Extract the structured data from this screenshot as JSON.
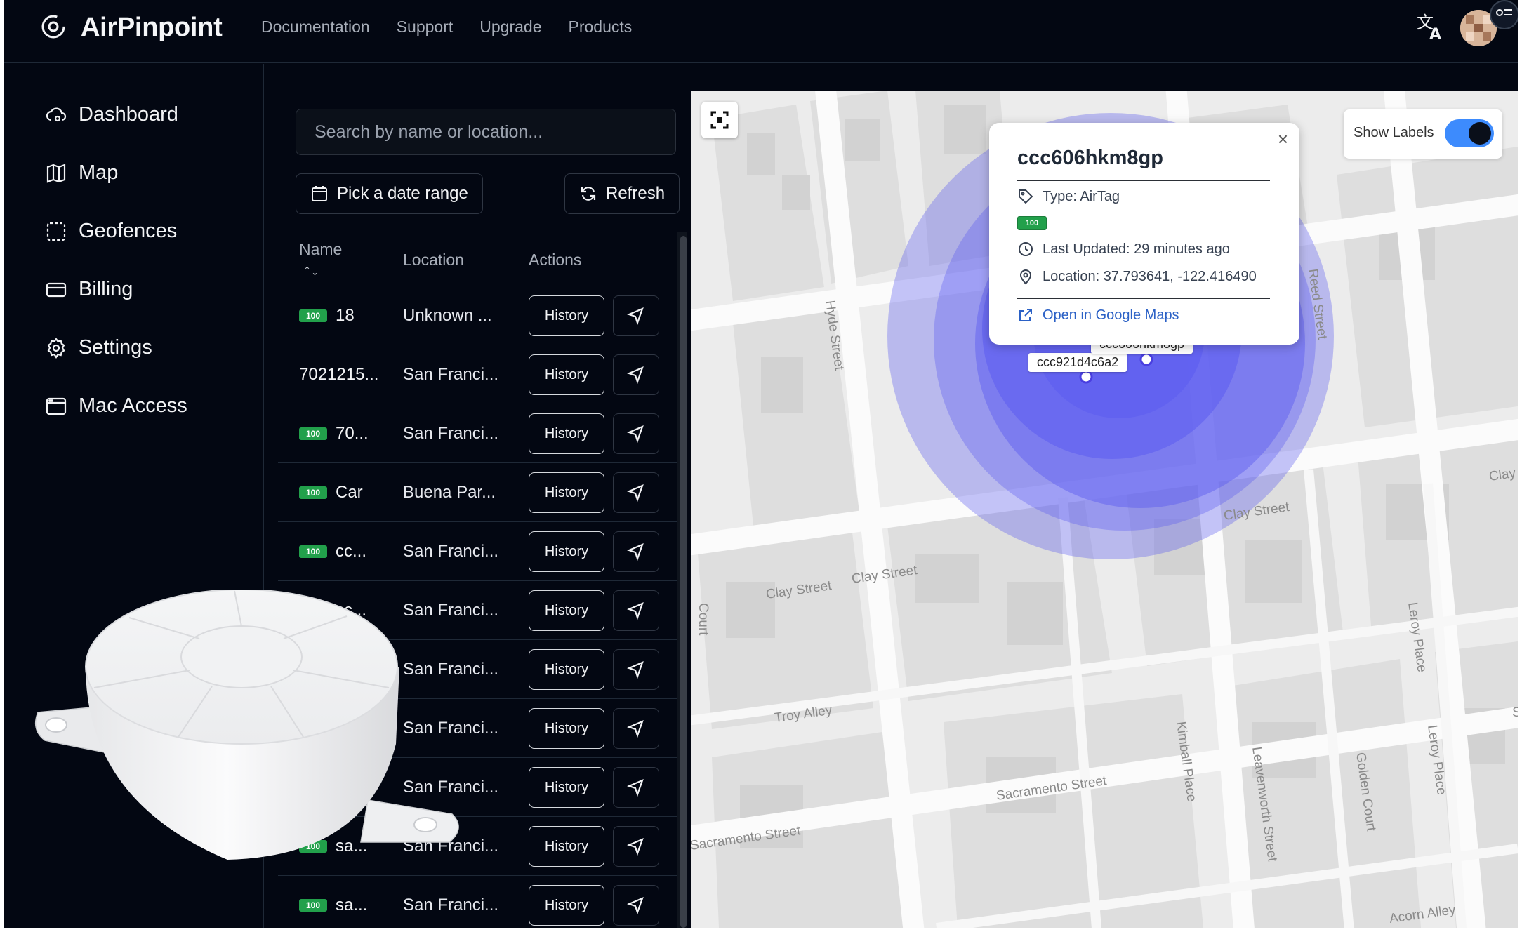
{
  "app": {
    "brand": "AirPinpoint"
  },
  "topnav": [
    "Documentation",
    "Support",
    "Upgrade",
    "Products"
  ],
  "sidebar": {
    "items": [
      {
        "label": "Dashboard",
        "icon": "cloud-gear-icon"
      },
      {
        "label": "Map",
        "icon": "map-icon"
      },
      {
        "label": "Geofences",
        "icon": "dashed-square-icon"
      },
      {
        "label": "Billing",
        "icon": "credit-card-icon"
      },
      {
        "label": "Settings",
        "icon": "gear-icon"
      },
      {
        "label": "Mac Access",
        "icon": "window-icon"
      }
    ]
  },
  "list": {
    "search_placeholder": "Search by name or location...",
    "date_range_label": "Pick a date range",
    "refresh_label": "Refresh",
    "columns": {
      "name": "Name",
      "sort_icon": "↑↓",
      "location": "Location",
      "actions": "Actions"
    },
    "history_label": "History",
    "battery_label": "100",
    "rows": [
      {
        "battery": true,
        "name": "18",
        "location": "Unknown ..."
      },
      {
        "battery": false,
        "name": "7021215...",
        "location": "San Franci..."
      },
      {
        "battery": true,
        "name": "70...",
        "location": "San Franci..."
      },
      {
        "battery": true,
        "name": "Car",
        "location": "Buena Par..."
      },
      {
        "battery": true,
        "name": "cc...",
        "location": "San Franci..."
      },
      {
        "battery": true,
        "name": "cc...",
        "location": "San Franci..."
      },
      {
        "battery": false,
        "name": "",
        "location": "San Franci..."
      },
      {
        "battery": false,
        "name": "",
        "location": "San Franci..."
      },
      {
        "battery": false,
        "name": "",
        "location": "San Franci..."
      },
      {
        "battery": true,
        "name": "sa...",
        "location": "San Franci..."
      },
      {
        "battery": true,
        "name": "sa...",
        "location": "San Franci..."
      }
    ]
  },
  "map": {
    "show_labels": "Show Labels",
    "show_labels_on": true,
    "streets": {
      "hyde": "Hyde Street",
      "reed": "Reed Street",
      "clay1": "Clay Street",
      "clay2": "Clay Street",
      "clay3": "Clay Street",
      "clay4": "Clay",
      "sacramento1": "Sacramento Street",
      "sacramento2": "Sacramento Street",
      "troy": "Troy Alley",
      "kimball": "Kimball Place",
      "leavenworth": "Leavenworth Street",
      "golden": "Golden Court",
      "leroy1": "Leroy Place",
      "leroy2": "Leroy Place",
      "acorn": "Acorn Alley",
      "court": "Court",
      "cut": "S"
    },
    "markers": [
      {
        "label": "ccc921d4c6a2"
      },
      {
        "label": "ccc606hkm8gp"
      }
    ],
    "accuracy_color": "#5b5bf0",
    "popup": {
      "title": "ccc606hkm8gp",
      "type": "Type: AirTag",
      "battery": "100",
      "last_updated": "Last Updated: 29 minutes ago",
      "location": "Location: 37.793641, -122.416490",
      "link": "Open in Google Maps",
      "close": "×"
    }
  }
}
